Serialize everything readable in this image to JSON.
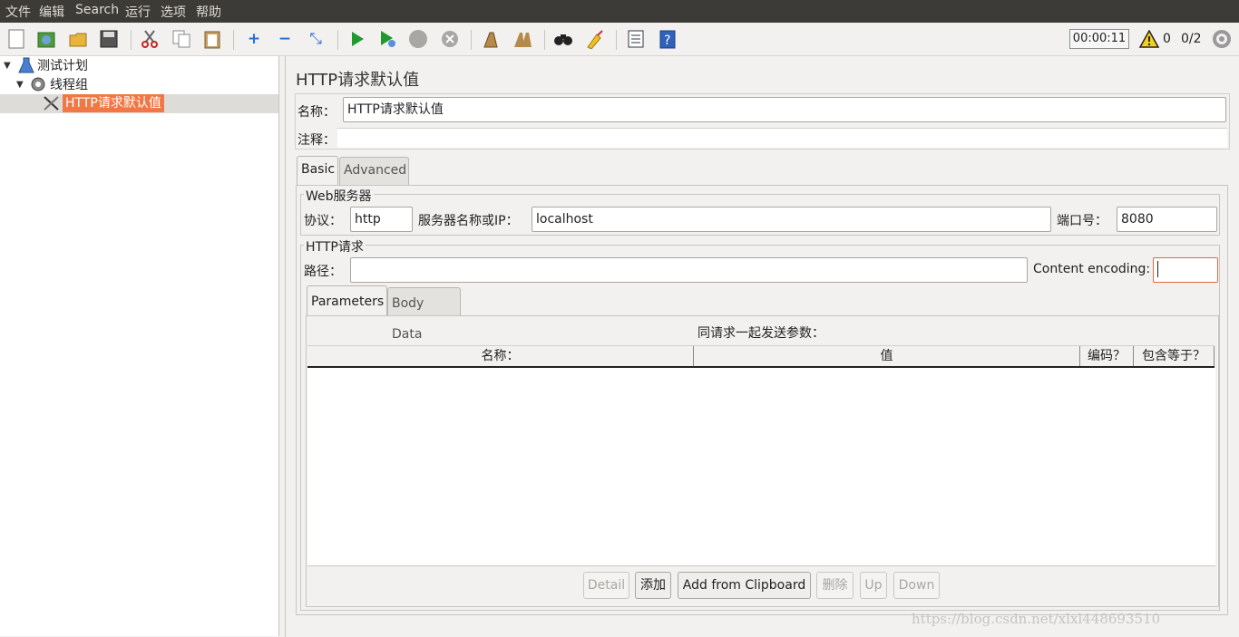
{
  "menu": [
    "文件",
    "编辑",
    "Search",
    "运行",
    "选项",
    "帮助"
  ],
  "toolbar": {
    "timer": "00:00:11",
    "warning_count": "0",
    "threads": "0/2"
  },
  "tree": {
    "root": "测试计划",
    "thread_group": "线程组",
    "selected": "HTTP请求默认值"
  },
  "panel": {
    "title": "HTTP请求默认值",
    "name_label": "名称：",
    "name_value": "HTTP请求默认值",
    "comment_label": "注释：",
    "comment_value": ""
  },
  "tabs": [
    "Basic",
    "Advanced"
  ],
  "web_server": {
    "title": "Web服务器",
    "protocol_label": "协议：",
    "protocol_value": "http",
    "server_label": "服务器名称或IP：",
    "server_value": "localhost",
    "port_label": "端口号：",
    "port_value": "8080"
  },
  "http_request": {
    "title": "HTTP请求",
    "path_label": "路径：",
    "path_value": "",
    "encoding_label": "Content encoding:",
    "encoding_value": ""
  },
  "subtabs": [
    "Parameters",
    "Body Data"
  ],
  "params": {
    "caption": "同请求一起发送参数：",
    "columns": [
      "名称：",
      "值",
      "编码？",
      "包含等于？"
    ]
  },
  "buttons": {
    "detail": "Detail",
    "add": "添加",
    "add_clipboard": "Add from Clipboard",
    "delete": "删除",
    "up": "Up",
    "down": "Down"
  },
  "watermark": "https://blog.csdn.net/xlxl448693510"
}
